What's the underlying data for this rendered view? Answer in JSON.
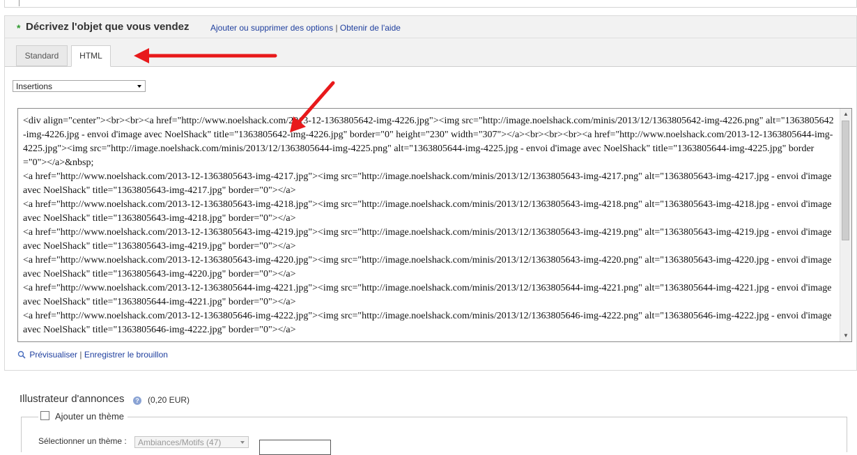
{
  "section": {
    "required_mark": "*",
    "title": "Décrivez l'objet que vous vendez",
    "link_options": "Ajouter ou supprimer des options",
    "separator": "|",
    "link_help": "Obtenir de l'aide"
  },
  "tabs": {
    "standard": "Standard",
    "html": "HTML"
  },
  "insertions": {
    "selected": "Insertions"
  },
  "editor": {
    "content": "<div align=\"center\"><br><br><a href=\"http://www.noelshack.com/2013-12-1363805642-img-4226.jpg\"><img src=\"http://image.noelshack.com/minis/2013/12/1363805642-img-4226.png\" alt=\"1363805642-img-4226.jpg - envoi d'image avec NoelShack\" title=\"1363805642-img-4226.jpg\" border=\"0\" height=\"230\" width=\"307\"></a><br><br><br><a href=\"http://www.noelshack.com/2013-12-1363805644-img-4225.jpg\"><img src=\"http://image.noelshack.com/minis/2013/12/1363805644-img-4225.png\" alt=\"1363805644-img-4225.jpg - envoi d'image avec NoelShack\" title=\"1363805644-img-4225.jpg\" border=\"0\"></a>&nbsp;\n<a href=\"http://www.noelshack.com/2013-12-1363805643-img-4217.jpg\"><img src=\"http://image.noelshack.com/minis/2013/12/1363805643-img-4217.png\" alt=\"1363805643-img-4217.jpg - envoi d'image avec NoelShack\" title=\"1363805643-img-4217.jpg\" border=\"0\"></a>\n<a href=\"http://www.noelshack.com/2013-12-1363805643-img-4218.jpg\"><img src=\"http://image.noelshack.com/minis/2013/12/1363805643-img-4218.png\" alt=\"1363805643-img-4218.jpg - envoi d'image avec NoelShack\" title=\"1363805643-img-4218.jpg\" border=\"0\"></a>\n<a href=\"http://www.noelshack.com/2013-12-1363805643-img-4219.jpg\"><img src=\"http://image.noelshack.com/minis/2013/12/1363805643-img-4219.png\" alt=\"1363805643-img-4219.jpg - envoi d'image avec NoelShack\" title=\"1363805643-img-4219.jpg\" border=\"0\"></a>\n<a href=\"http://www.noelshack.com/2013-12-1363805643-img-4220.jpg\"><img src=\"http://image.noelshack.com/minis/2013/12/1363805643-img-4220.png\" alt=\"1363805643-img-4220.jpg - envoi d'image avec NoelShack\" title=\"1363805643-img-4220.jpg\" border=\"0\"></a>\n<a href=\"http://www.noelshack.com/2013-12-1363805644-img-4221.jpg\"><img src=\"http://image.noelshack.com/minis/2013/12/1363805644-img-4221.png\" alt=\"1363805644-img-4221.jpg - envoi d'image avec NoelShack\" title=\"1363805644-img-4221.jpg\" border=\"0\"></a>\n<a href=\"http://www.noelshack.com/2013-12-1363805646-img-4222.jpg\"><img src=\"http://image.noelshack.com/minis/2013/12/1363805646-img-4222.png\" alt=\"1363805646-img-4222.jpg - envoi d'image avec NoelShack\" title=\"1363805646-img-4222.jpg\" border=\"0\"></a>"
  },
  "preview_links": {
    "preview": "Prévisualiser",
    "separator": "|",
    "save_draft": "Enregistrer le brouillon"
  },
  "illustrator": {
    "title": "Illustrateur d'annonces",
    "help_icon": "question-mark-icon",
    "price": "(0,20 EUR)",
    "add_theme": "Ajouter un thème",
    "select_label": "Sélectionner un thème :",
    "theme_value": "Ambiances/Motifs (47)"
  },
  "colors": {
    "link": "#1f3f9e",
    "required_star": "#2e9a2e",
    "annotation_arrow": "#e8191b"
  }
}
